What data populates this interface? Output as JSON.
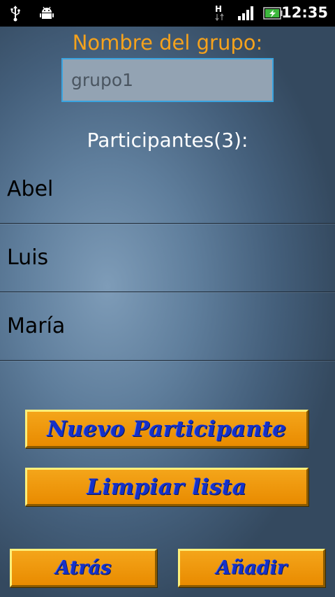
{
  "status_bar": {
    "time": "12:35",
    "network_type": "H",
    "icons": [
      "usb-icon",
      "android-debug-icon",
      "h-network-icon",
      "signal-icon",
      "battery-charging-icon"
    ]
  },
  "group": {
    "label": "Nombre del grupo:",
    "input_value": "grupo1"
  },
  "participants": {
    "heading": "Participantes(3):",
    "items": [
      {
        "name": "Abel"
      },
      {
        "name": "Luis"
      },
      {
        "name": "María"
      }
    ]
  },
  "buttons": {
    "new_participant": "Nuevo Participante",
    "clear_list": "Limpiar lista",
    "back": "Atrás",
    "add": "Añadir"
  },
  "colors": {
    "label_orange": "#f5a21c",
    "button_orange": "#f4a51a",
    "button_text_blue": "#1530c8",
    "input_border": "#3aa4e0"
  }
}
